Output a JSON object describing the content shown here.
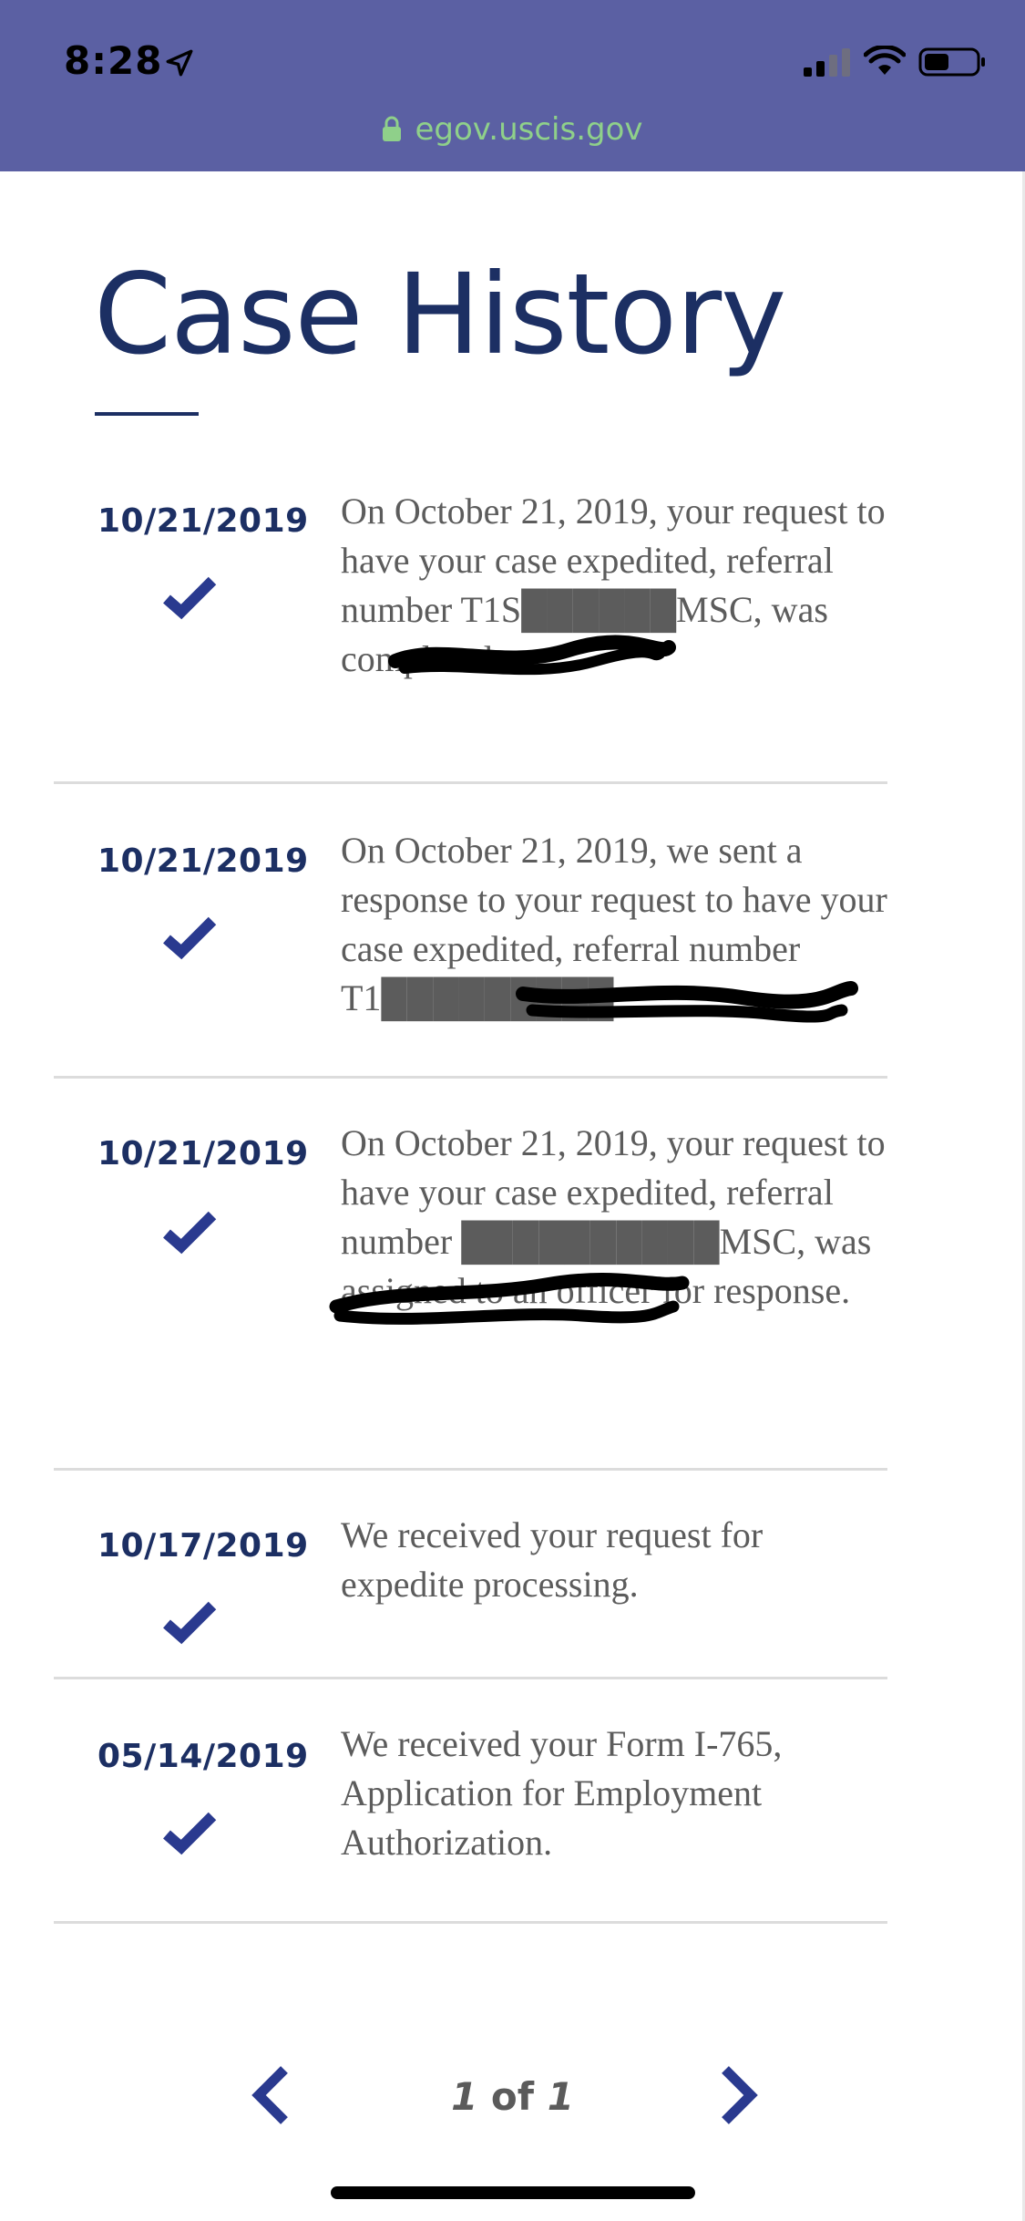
{
  "status_bar": {
    "time": "8:28",
    "url": "egov.uscis.gov"
  },
  "page": {
    "title": "Case History"
  },
  "history": [
    {
      "date": "10/21/2019",
      "text": "On October 21, 2019, your request to have your case expedited, referral number T1S██████MSC, was completed."
    },
    {
      "date": "10/21/2019",
      "text": "On October 21, 2019, we sent a response to your request to have your case expedited, referral number T1█████████."
    },
    {
      "date": "10/21/2019",
      "text": "On October 21, 2019, your request to have your case expedited, referral number ██████████MSC, was assigned to an officer for response."
    },
    {
      "date": "10/17/2019",
      "text": "We received your request for expedite processing."
    },
    {
      "date": "05/14/2019",
      "text": "We received your Form I-765, Application for Employment Authorization."
    }
  ],
  "pagination": {
    "current": "1",
    "separator": "of",
    "total": "1"
  },
  "colors": {
    "top_bar": "#5b60a3",
    "url_text": "#8fd08a",
    "heading": "#1c2f63",
    "check": "#2a3a8f",
    "body_text": "#5c5c5c",
    "divider": "#dcdcdc"
  },
  "icons": {
    "location": "location-arrow-icon",
    "signal": "cellular-signal-icon",
    "wifi": "wifi-icon",
    "battery": "battery-icon",
    "lock": "lock-icon",
    "check": "checkmark-icon",
    "prev": "chevron-left-icon",
    "next": "chevron-right-icon"
  }
}
